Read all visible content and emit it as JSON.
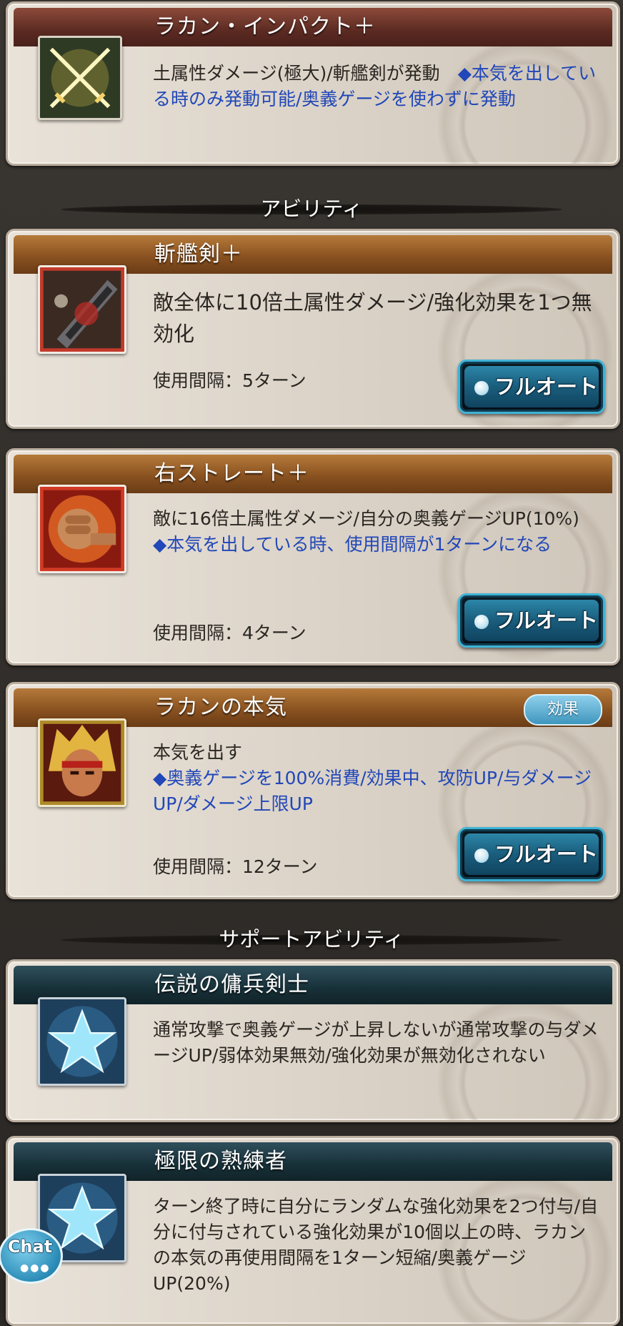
{
  "ougi": {
    "title": "ラカン・インパクト＋",
    "icon": "crossed-swords-icon",
    "desc_main": "土属性ダメージ(極大)/斬艦剣が発動　",
    "desc_blue": "◆本気を出している時のみ発動可能/奥義ゲージを使わずに発動"
  },
  "sections": {
    "ability": "アビリティ",
    "support": "サポートアビリティ"
  },
  "abilities": [
    {
      "title": "斬艦剣＋",
      "icon": "giant-sword-icon",
      "desc_main": "敵全体に10倍土属性ダメージ/強化効果を1つ無効化",
      "desc_blue": "",
      "cooldown": "使用間隔：5ターン",
      "button": "フルオート"
    },
    {
      "title": "右ストレート＋",
      "icon": "fist-punch-icon",
      "desc_main": "敵に16倍土属性ダメージ/自分の奥義ゲージUP(10%)　",
      "desc_blue": "◆本気を出している時、使用間隔が1ターンになる",
      "cooldown": "使用間隔：4ターン",
      "button": "フルオート"
    },
    {
      "title": "ラカンの本気",
      "icon": "rakan-portrait-icon",
      "badge": "効果",
      "desc_main": "本気を出す",
      "desc_blue": "◆奥義ゲージを100%消費/効果中、攻防UP/与ダメージUP/ダメージ上限UP",
      "cooldown": "使用間隔：12ターン",
      "button": "フルオート"
    }
  ],
  "supports": [
    {
      "title": "伝説の傭兵剣士",
      "icon": "star-icon",
      "desc": "通常攻撃で奥義ゲージが上昇しないが通常攻撃の与ダメージUP/弱体効果無効/強化効果が無効化されない"
    },
    {
      "title": "極限の熟練者",
      "icon": "star-icon",
      "desc": "ターン終了時に自分にランダムな強化効果を2つ付与/自分に付与されている強化効果が10個以上の時、ラカンの本気の再使用間隔を1ターン短縮/奥義ゲージUP(20%)"
    }
  ],
  "chat": {
    "label": "Chat"
  },
  "colors": {
    "blue_text": "#2147b8",
    "button_blue": "#2c86a8",
    "header_red": "#5b2a22",
    "header_brown": "#8a5220",
    "header_teal": "#173038"
  }
}
